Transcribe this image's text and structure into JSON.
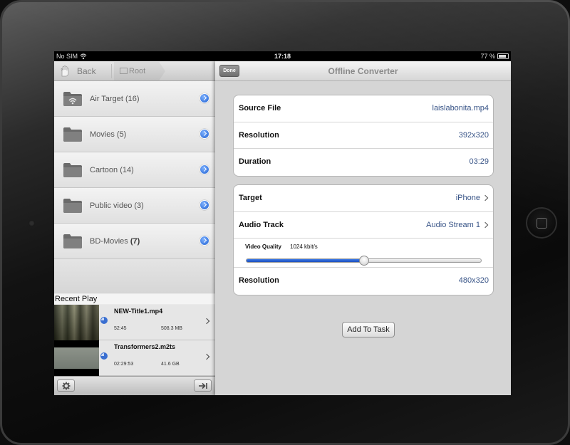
{
  "status_bar": {
    "carrier": "No SIM",
    "time": "17:18",
    "battery": "77 %"
  },
  "left_nav": {
    "back_label": "Back",
    "root_label": "Root"
  },
  "folders": [
    {
      "name": "Air Target",
      "count": "(16)",
      "icon": "wifi-folder-icon"
    },
    {
      "name": "Movies",
      "count": "(5)",
      "icon": "folder-icon"
    },
    {
      "name": "Cartoon",
      "count": "(14)",
      "icon": "folder-icon"
    },
    {
      "name": "Public video",
      "count": "(3)",
      "icon": "folder-icon"
    },
    {
      "name": "BD-Movies",
      "count": "(7)",
      "icon": "folder-icon"
    }
  ],
  "recent": {
    "header": "Recent Play",
    "items": [
      {
        "title": "NEW-Title1.mp4",
        "duration": "52:45",
        "size": "508.3 MB"
      },
      {
        "title": "Transformers2.m2ts",
        "duration": "02:29:53",
        "size": "41.6 GB"
      }
    ]
  },
  "converter": {
    "done_label": "Done",
    "title": "Offline Converter",
    "source": [
      {
        "label": "Source File",
        "value": "laislabonita.mp4"
      },
      {
        "label": "Resolution",
        "value": "392x320"
      },
      {
        "label": "Duration",
        "value": "03:29"
      }
    ],
    "target": {
      "label": "Target",
      "value": "iPhone"
    },
    "audio": {
      "label": "Audio Track",
      "value": "Audio Stream 1"
    },
    "video_quality": {
      "label": "Video Quality",
      "value": "1024 kbit/s",
      "level": 0.5
    },
    "output_resolution": {
      "label": "Resolution",
      "value": "480x320"
    },
    "add_button": "Add To Task"
  },
  "colors": {
    "accent_blue": "#2060d0",
    "value_text": "#385487"
  }
}
